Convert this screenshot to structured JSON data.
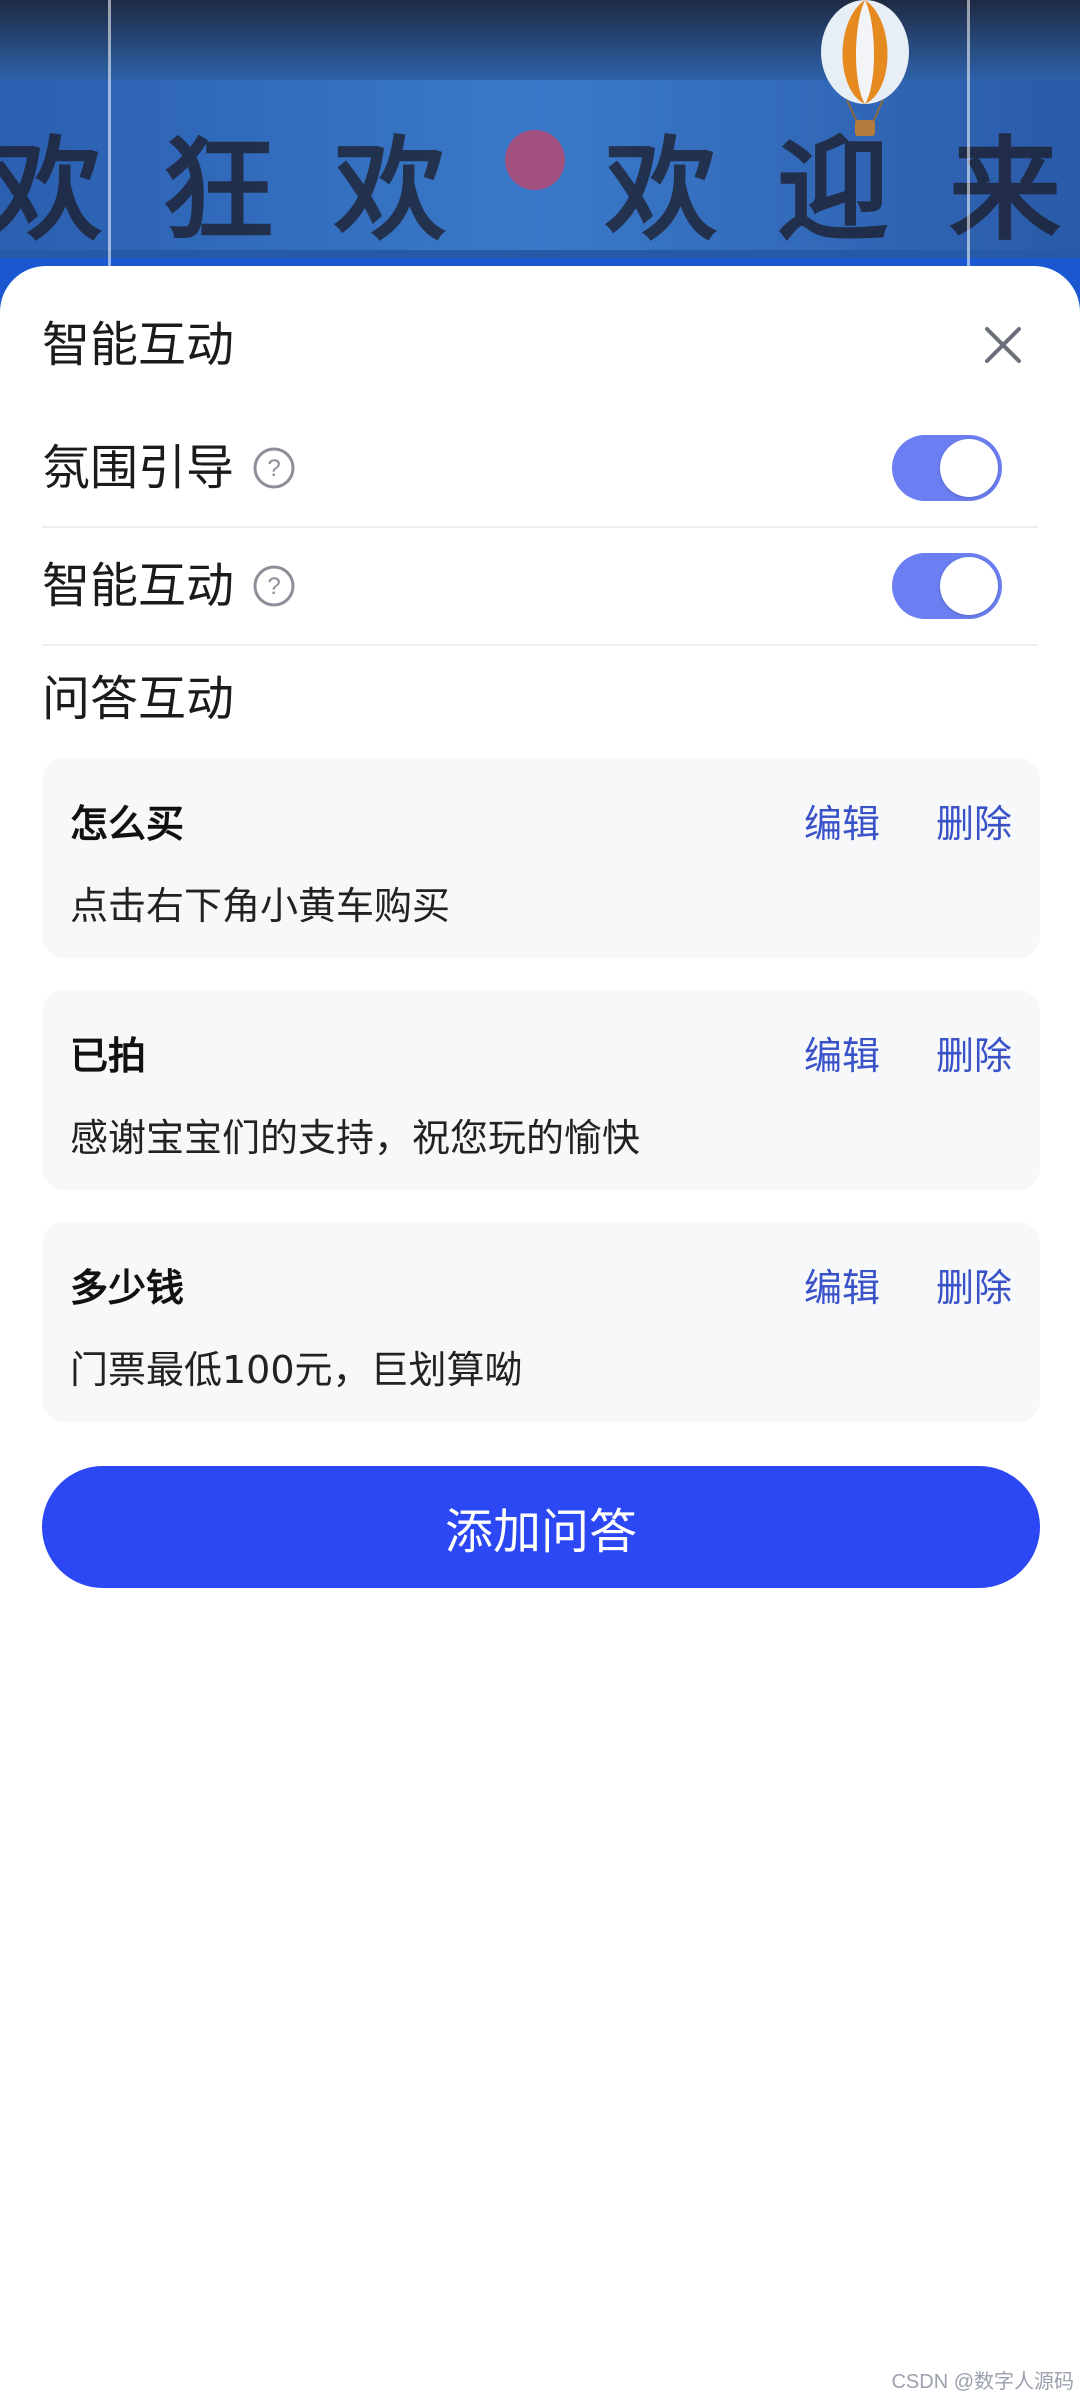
{
  "background": {
    "scene_text": "欢狂欢  欢迎来"
  },
  "sheet": {
    "title": "智能互动",
    "close_icon": "close-icon"
  },
  "settings": [
    {
      "label": "氛围引导",
      "help_icon": "question-circle-icon",
      "enabled": true
    },
    {
      "label": "智能互动",
      "help_icon": "question-circle-icon",
      "enabled": true
    }
  ],
  "qa_section": {
    "title": "问答互动",
    "items": [
      {
        "question": "怎么买",
        "answer": "点击右下角小黄车购买",
        "edit_label": "编辑",
        "delete_label": "删除"
      },
      {
        "question": "已拍",
        "answer": "感谢宝宝们的支持，祝您玩的愉快",
        "edit_label": "编辑",
        "delete_label": "删除"
      },
      {
        "question": "多少钱",
        "answer": "门票最低100元，巨划算呦",
        "edit_label": "编辑",
        "delete_label": "删除"
      }
    ],
    "add_button_label": "添加问答"
  },
  "colors": {
    "accent": "#2b48f4",
    "toggle_on": "#6b7ff2",
    "link": "#3a52c8",
    "card_bg": "#f7f8fa"
  },
  "watermark": "CSDN @数字人源码"
}
